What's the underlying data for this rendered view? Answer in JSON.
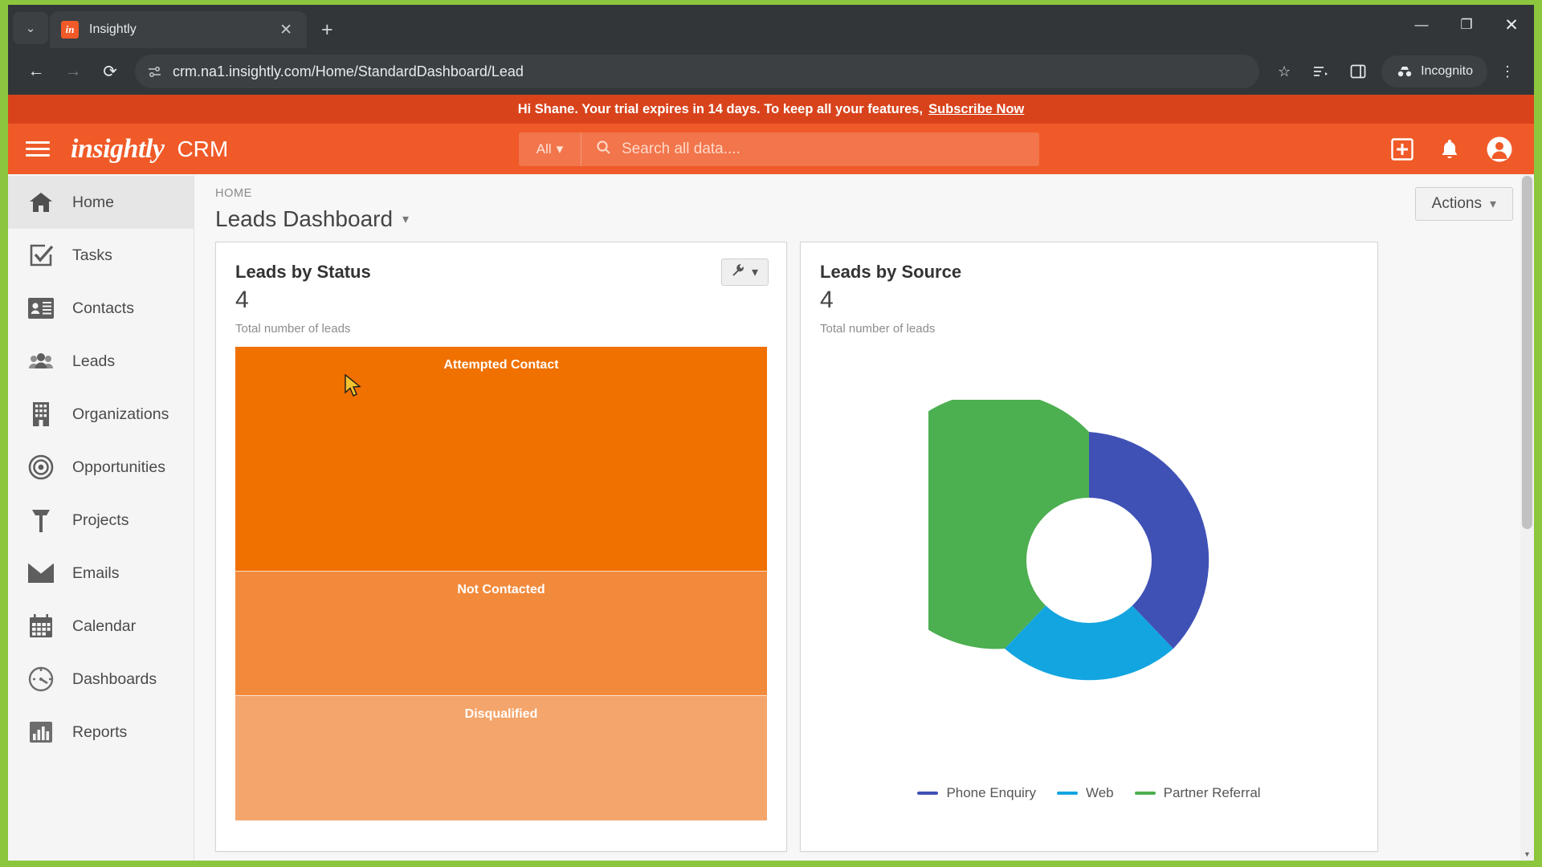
{
  "browser": {
    "tab": {
      "title": "Insightly",
      "favicon_letter": "in",
      "close_icon": "✕"
    },
    "new_tab_icon": "+",
    "tab_list_icon": "⌄",
    "window_controls": {
      "minimize": "—",
      "maximize": "❐",
      "close": "✕"
    },
    "nav": {
      "back_icon": "←",
      "forward_icon": "→",
      "reload_icon": "⟳"
    },
    "url": "crm.na1.insightly.com/Home/StandardDashboard/Lead",
    "site_info_icon": "page-info-icon",
    "bookmark_icon": "☆",
    "reading_list_icon": "reading-list-icon",
    "side_panel_icon": "side-panel-icon",
    "incognito_label": "Incognito",
    "menu_icon": "⋮"
  },
  "banner": {
    "message": "Hi Shane. Your trial expires in 14 days. To keep all your features,",
    "cta": "Subscribe Now"
  },
  "appheader": {
    "brand": "insightly",
    "product": "CRM",
    "search": {
      "scope": "All",
      "placeholder": "Search all data...."
    },
    "icons": {
      "add": "add-icon",
      "notifications": "bell-icon",
      "profile": "account-icon"
    }
  },
  "sidebar": {
    "items": [
      {
        "label": "Home",
        "icon": "home-icon",
        "active": true
      },
      {
        "label": "Tasks",
        "icon": "task-check-icon",
        "active": false
      },
      {
        "label": "Contacts",
        "icon": "contact-card-icon",
        "active": false
      },
      {
        "label": "Leads",
        "icon": "people-icon",
        "active": false
      },
      {
        "label": "Organizations",
        "icon": "building-icon",
        "active": false
      },
      {
        "label": "Opportunities",
        "icon": "target-icon",
        "active": false
      },
      {
        "label": "Projects",
        "icon": "hammer-icon",
        "active": false
      },
      {
        "label": "Emails",
        "icon": "envelope-icon",
        "active": false
      },
      {
        "label": "Calendar",
        "icon": "calendar-icon",
        "active": false
      },
      {
        "label": "Dashboards",
        "icon": "gauge-icon",
        "active": false
      },
      {
        "label": "Reports",
        "icon": "bar-chart-icon",
        "active": false
      }
    ]
  },
  "main": {
    "breadcrumb": "HOME",
    "title": "Leads Dashboard",
    "title_caret": "▾",
    "actions_button": "Actions",
    "actions_caret": "▾"
  },
  "cards": {
    "leads_by_status": {
      "title": "Leads by Status",
      "value": "4",
      "subtitle": "Total number of leads",
      "tool_icon": "wrench-icon",
      "tool_caret": "▾"
    },
    "leads_by_source": {
      "title": "Leads by Source",
      "value": "4",
      "subtitle": "Total number of leads"
    }
  },
  "chart_data": [
    {
      "type": "bar",
      "title": "Leads by Status",
      "orientation": "stacked-vertical",
      "categories": [
        "Attempted Contact",
        "Not Contacted",
        "Disqualified"
      ],
      "values": [
        2,
        1,
        1
      ],
      "total": 4,
      "colors": [
        "#F07000",
        "#F28A3C",
        "#F4A56B"
      ],
      "xlabel": "",
      "ylabel": "Total number of leads",
      "legend": false,
      "grid": false
    },
    {
      "type": "pie",
      "subtype": "donut",
      "title": "Leads by Source",
      "categories": [
        "Phone Enquiry",
        "Web",
        "Partner Referral"
      ],
      "values": [
        1,
        1,
        2
      ],
      "total": 4,
      "colors": [
        "#3F51B5",
        "#13A5E0",
        "#4CAF50"
      ],
      "legend": true,
      "legend_position": "bottom"
    }
  ],
  "theme": {
    "brand_orange": "#F05A28",
    "banner_red": "#D8431C",
    "green_border": "#8CC63E",
    "chrome_dark": "#323639"
  }
}
